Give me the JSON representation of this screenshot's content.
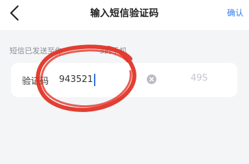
{
  "navbar": {
    "back_icon": "chevron-left-icon",
    "title": "输入短信验证码",
    "action_label": "确认"
  },
  "hint": {
    "prefix": "短信已发送至你",
    "suffix": "3的手机"
  },
  "verification": {
    "label": "验证码",
    "value": "943521",
    "clear_icon": "clear-circle-icon",
    "countdown": "49S"
  },
  "colors": {
    "accent": "#2f7ef0",
    "annotation": "#e02a1c"
  }
}
